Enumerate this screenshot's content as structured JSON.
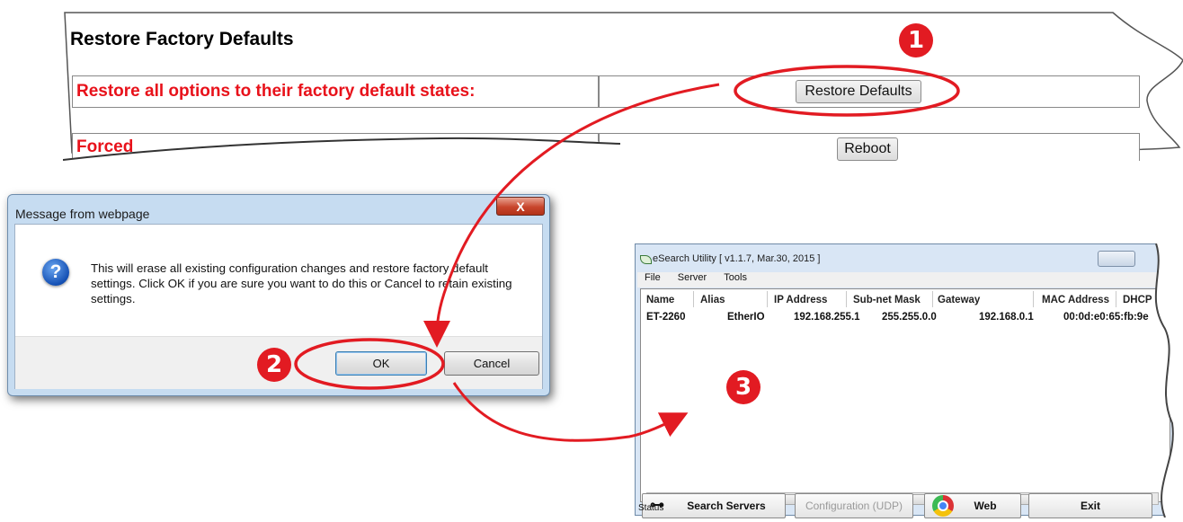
{
  "restore_panel": {
    "title": "Restore Factory Defaults",
    "restore_label": "Restore all options to their factory default states:",
    "restore_button": "Restore Defaults",
    "forced_label": "Forced",
    "reboot_button": "Reboot"
  },
  "dialog": {
    "title": "Message from webpage",
    "close_glyph": "X",
    "message": "This will erase all existing configuration changes and restore factory default settings. Click OK if you are sure you want to do this or Cancel to retain existing settings.",
    "ok_label": "OK",
    "cancel_label": "Cancel",
    "icon": "question-icon"
  },
  "esearch": {
    "title": "eSearch Utility [ v1.1.7, Mar.30, 2015 ]",
    "menu": [
      "File",
      "Server",
      "Tools"
    ],
    "columns": [
      "Name",
      "Alias",
      "IP Address",
      "Sub-net Mask",
      "Gateway",
      "MAC Address",
      "DHCP"
    ],
    "rows": [
      {
        "name": "ET-2260",
        "alias": "EtherIO",
        "ip": "192.168.255.1",
        "mask": "255.255.0.0",
        "gateway": "192.168.0.1",
        "mac": "00:0d:e0:65:fb:9e"
      }
    ],
    "buttons": {
      "search": "Search Servers",
      "config": "Configuration (UDP)",
      "web": "Web",
      "exit": "Exit"
    },
    "status": "Status"
  },
  "markers": [
    "1",
    "2",
    "3"
  ],
  "colors": {
    "annotation_red": "#e21b22",
    "label_red": "#e8111a"
  }
}
